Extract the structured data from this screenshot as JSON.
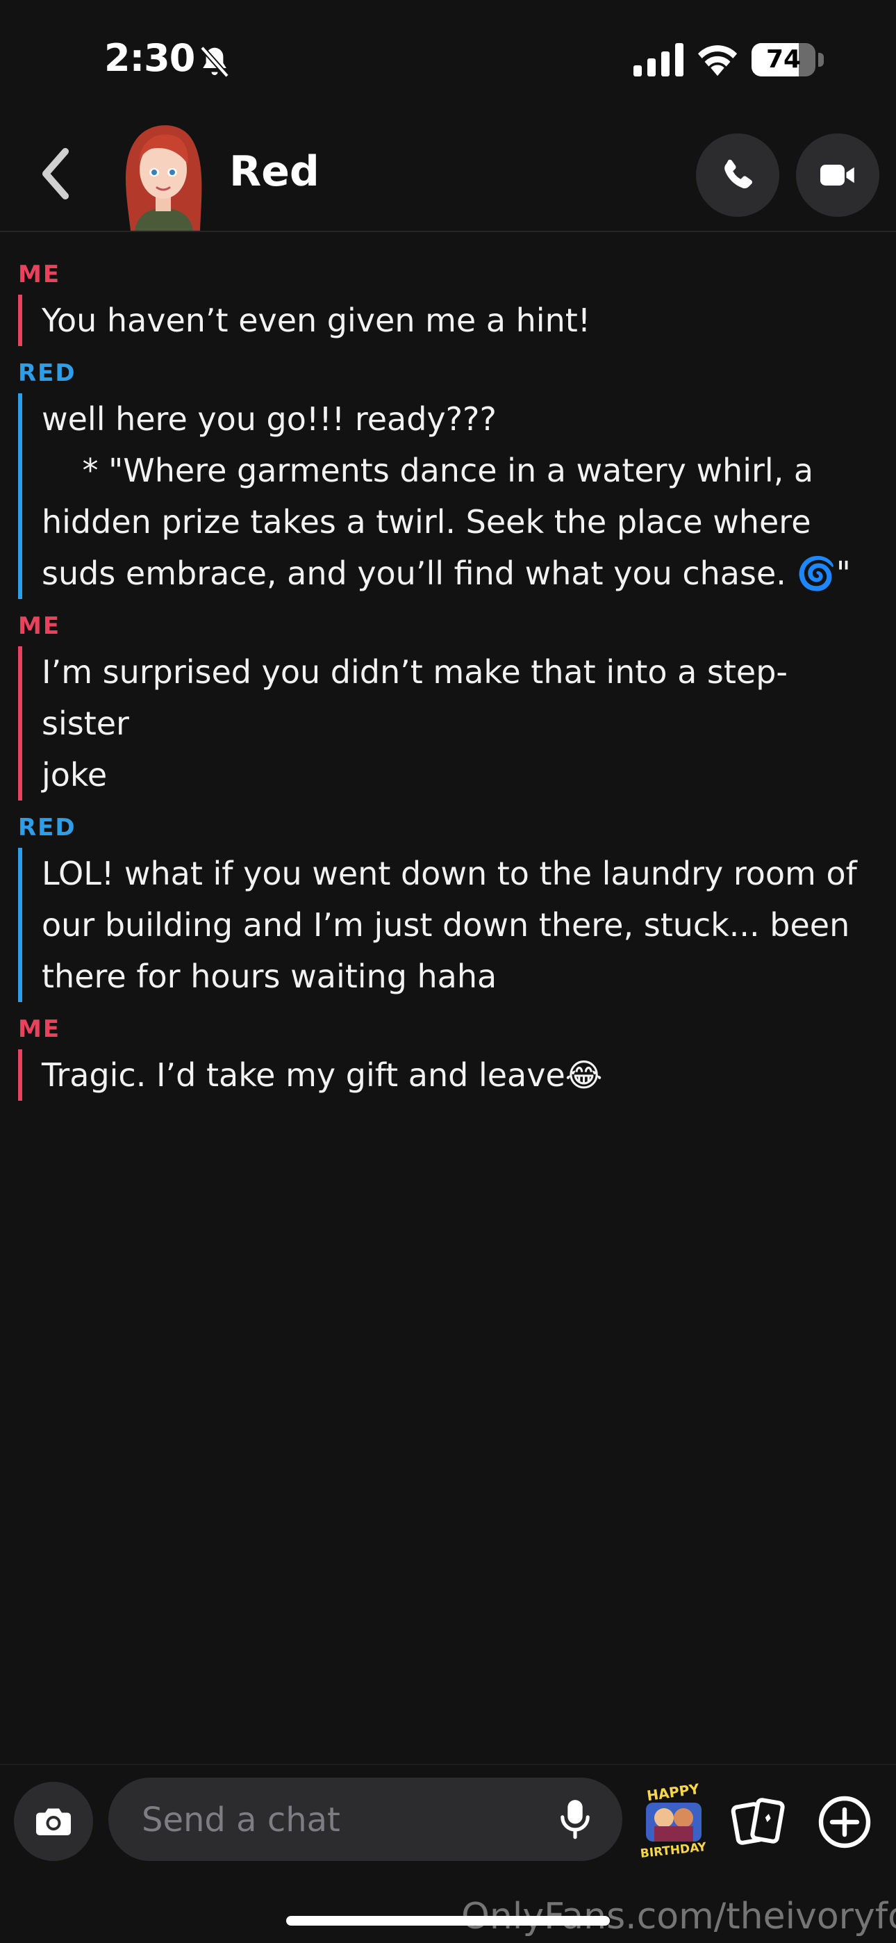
{
  "status_bar": {
    "time": "2:30",
    "battery_level": "74",
    "battery_fraction": 0.74
  },
  "header": {
    "contact_name": "Red"
  },
  "messages": [
    {
      "sender": "ME",
      "lines": [
        "You haven’t even given me a hint!"
      ]
    },
    {
      "sender": "RED",
      "lines": [
        "well here you go!!! ready???",
        "    * \"Where garments dance in a watery whirl, a",
        "hidden prize takes a twirl. Seek the place where",
        "suds embrace, and you’ll find what you chase. 🌀\""
      ]
    },
    {
      "sender": "ME",
      "lines": [
        "I’m surprised you didn’t make that into a step-sister",
        "joke"
      ]
    },
    {
      "sender": "RED",
      "lines": [
        "LOL! what if you went down to the laundry room of",
        "our building and I’m just down there, stuck... been",
        "there for hours waiting haha"
      ]
    },
    {
      "sender": "ME",
      "lines": [
        "Tragic. I’d take my gift and leave😂"
      ]
    }
  ],
  "composer": {
    "placeholder": "Send a chat",
    "sticker_text": "HAPPY BIRTHDAY"
  },
  "watermark": "OnlyFans.com/theivoryfox",
  "colors": {
    "me": "#e9425d",
    "red": "#2f9ee8",
    "background": "#121213"
  }
}
